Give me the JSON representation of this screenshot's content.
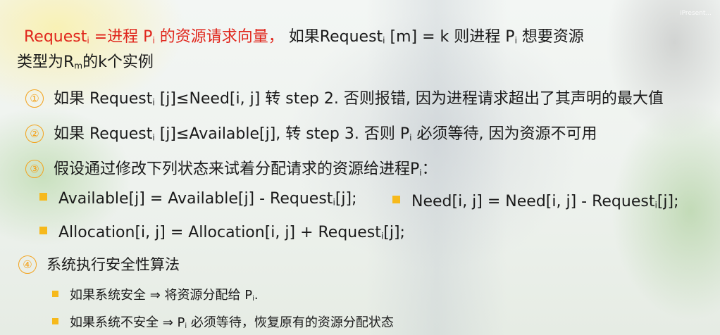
{
  "watermark": "iPresent...",
  "title": {
    "red_part": "Request",
    "red_sub": "i",
    "red_rest_1": " =进程 P",
    "red_sub_2": "i",
    "red_rest_2": " 的资源请求向量，",
    "black_part": " 如果Request",
    "black_sub": "i",
    "black_rest_1": " [m] = k 则进程 P",
    "black_sub_2": "i",
    "black_rest_2": " 想要资源",
    "line2_a": "类型为R",
    "line2_sub": "m",
    "line2_b": "的k个实例"
  },
  "steps": [
    {
      "num": "①",
      "a": "如果 Request",
      "sub": "i",
      "b": " [j]≤Need[i, j] 转 step 2.  否则报错, 因为进程请求超出了其声明的最大值"
    },
    {
      "num": "②",
      "a": "如果 Request",
      "sub": "i",
      "b": " [j]≤Available[j], 转 step 3.  否则 P",
      "sub2": "i",
      "c": "  必须等待, 因为资源不可用"
    },
    {
      "num": "③",
      "a": "假设通过修改下列状态来试着分配请求的资源给进程P",
      "sub": "i",
      "b": "："
    },
    {
      "num": "④",
      "a": "系统执行安全性算法"
    }
  ],
  "assign": {
    "available_a": "Available[j] = Available[j] - Request",
    "available_sub": "i",
    "available_b": "[j];",
    "need_a": "Need[i, j] = Need[i, j] -  Request",
    "need_sub": "i",
    "need_b": "[j];",
    "alloc_a": "Allocation[i, j] = Allocation[i, j] + Request",
    "alloc_sub": "i",
    "alloc_b": "[j];"
  },
  "safety": [
    {
      "a": "如果系统安全 ⇒ 将资源分配给 P",
      "sub": "i",
      "b": "."
    },
    {
      "a": "如果系统不安全 ⇒ P",
      "sub": "i",
      "b": " 必须等待，恢复原有的资源分配状态"
    }
  ]
}
